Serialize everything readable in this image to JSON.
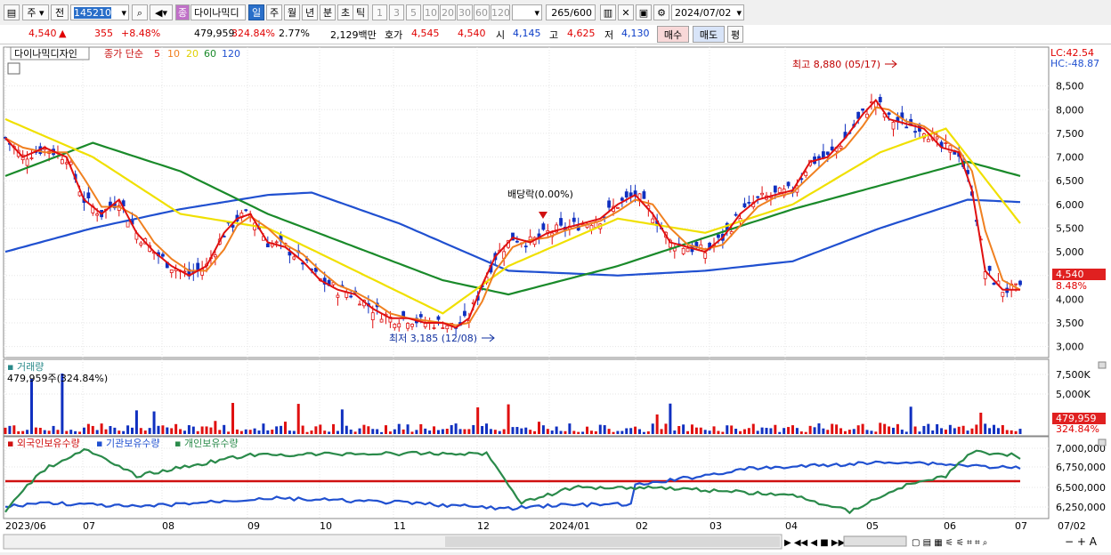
{
  "toolbar": {
    "type1": "주",
    "type2": "전",
    "code": "145210",
    "mark": "종",
    "name": "다이나믹디",
    "periods": [
      "일",
      "주",
      "월",
      "년",
      "분",
      "초",
      "틱"
    ],
    "numbers": [
      "1",
      "3",
      "5",
      "10",
      "20",
      "30",
      "60",
      "120"
    ],
    "count": "265",
    "total": "/600",
    "date": "2024/07/02"
  },
  "info": {
    "price": "4,540",
    "arrow": "▲",
    "change": "355",
    "rate": "+8.48%",
    "volume": "479,959",
    "vol_rate": "324.84%",
    "turnover": "2.77%",
    "amount": "2,129백만",
    "quote_label": "호가",
    "ask": "4,545",
    "bid": "4,540",
    "open_label": "시",
    "open": "4,145",
    "high_label": "고",
    "high": "4,625",
    "low_label": "저",
    "low": "4,130",
    "buy": "매수",
    "sell": "매도",
    "eval": "평"
  },
  "price_panel": {
    "title": "다이나믹디자인",
    "ma_label": "종가 단순",
    "ma": [
      {
        "period": "5",
        "color": "#e01010"
      },
      {
        "period": "10",
        "color": "#f08020"
      },
      {
        "period": "20",
        "color": "#f0e000"
      },
      {
        "period": "60",
        "color": "#1a8a2a"
      },
      {
        "period": "120",
        "color": "#2050d0"
      }
    ],
    "lc": "LC:42.54",
    "hc": "HC:-48.87",
    "high_note": "최고 8,880 (05/17)",
    "low_note": "최저 3,185 (12/08)",
    "div_note": "배당락(0.00%)",
    "cur_price": "4,540",
    "cur_rate": "8.48%"
  },
  "volume_panel": {
    "title": "거래량",
    "value": "479,959주(324.84%)",
    "cur": "479,959",
    "cur_rate": "324.84%"
  },
  "holdings_panel": {
    "series": [
      {
        "name": "외국인보유수량",
        "color": "#d01010"
      },
      {
        "name": "기관보유수량",
        "color": "#2050d0"
      },
      {
        "name": "개인보유수량",
        "color": "#2a8a4a"
      }
    ]
  },
  "chart_data": {
    "type": "candlestick",
    "price_axis": [
      "8,500",
      "8,000",
      "7,500",
      "7,000",
      "6,500",
      "6,000",
      "5,500",
      "5,000",
      "4,500",
      "4,000",
      "3,500",
      "3,000"
    ],
    "price_ylim": [
      2900,
      9000
    ],
    "volume_axis": [
      "7,500K",
      "5,000K"
    ],
    "holdings_axis": [
      "7,000,000",
      "6,750,000",
      "6,500,000",
      "6,250,000"
    ],
    "x_labels": [
      "2023/06",
      "07",
      "08",
      "09",
      "10",
      "11",
      "12",
      "2024/01",
      "02",
      "03",
      "04",
      "05",
      "06",
      "07",
      "07/02"
    ],
    "ma5_close": [
      [
        0,
        7400
      ],
      [
        4,
        7000
      ],
      [
        9,
        7200
      ],
      [
        14,
        7000
      ],
      [
        18,
        6100
      ],
      [
        22,
        5800
      ],
      [
        26,
        6100
      ],
      [
        30,
        5400
      ],
      [
        34,
        5000
      ],
      [
        38,
        4700
      ],
      [
        42,
        4500
      ],
      [
        46,
        4700
      ],
      [
        50,
        5400
      ],
      [
        53,
        5700
      ],
      [
        56,
        5800
      ],
      [
        60,
        5200
      ],
      [
        64,
        5100
      ],
      [
        68,
        4800
      ],
      [
        72,
        4400
      ],
      [
        76,
        4200
      ],
      [
        80,
        4100
      ],
      [
        84,
        3800
      ],
      [
        88,
        3600
      ],
      [
        92,
        3600
      ],
      [
        96,
        3500
      ],
      [
        100,
        3500
      ],
      [
        103,
        3400
      ],
      [
        106,
        3600
      ],
      [
        109,
        4300
      ],
      [
        112,
        4900
      ],
      [
        116,
        5300
      ],
      [
        120,
        5200
      ],
      [
        124,
        5400
      ],
      [
        128,
        5500
      ],
      [
        132,
        5600
      ],
      [
        136,
        5700
      ],
      [
        140,
        6000
      ],
      [
        144,
        6200
      ],
      [
        148,
        5800
      ],
      [
        152,
        5200
      ],
      [
        156,
        5100
      ],
      [
        160,
        5000
      ],
      [
        164,
        5300
      ],
      [
        168,
        5800
      ],
      [
        172,
        6100
      ],
      [
        176,
        6200
      ],
      [
        180,
        6300
      ],
      [
        184,
        6900
      ],
      [
        188,
        7000
      ],
      [
        192,
        7400
      ],
      [
        196,
        7900
      ],
      [
        199,
        8200
      ],
      [
        202,
        7800
      ],
      [
        206,
        7700
      ],
      [
        210,
        7600
      ],
      [
        214,
        7200
      ],
      [
        218,
        7100
      ],
      [
        221,
        6300
      ],
      [
        224,
        4600
      ],
      [
        228,
        4200
      ],
      [
        232,
        4200
      ]
    ],
    "ma20": [
      [
        0,
        7800
      ],
      [
        20,
        7000
      ],
      [
        40,
        5800
      ],
      [
        60,
        5500
      ],
      [
        80,
        4600
      ],
      [
        100,
        3700
      ],
      [
        115,
        4700
      ],
      [
        140,
        5700
      ],
      [
        160,
        5400
      ],
      [
        180,
        6000
      ],
      [
        200,
        7100
      ],
      [
        215,
        7600
      ],
      [
        232,
        5600
      ]
    ],
    "ma60": [
      [
        0,
        6600
      ],
      [
        20,
        7300
      ],
      [
        40,
        6700
      ],
      [
        60,
        5800
      ],
      [
        80,
        5100
      ],
      [
        100,
        4400
      ],
      [
        115,
        4100
      ],
      [
        140,
        4700
      ],
      [
        160,
        5300
      ],
      [
        180,
        5900
      ],
      [
        200,
        6400
      ],
      [
        220,
        6900
      ],
      [
        232,
        6600
      ]
    ],
    "ma120": [
      [
        0,
        5000
      ],
      [
        20,
        5500
      ],
      [
        40,
        5900
      ],
      [
        60,
        6200
      ],
      [
        70,
        6250
      ],
      [
        90,
        5600
      ],
      [
        115,
        4600
      ],
      [
        140,
        4500
      ],
      [
        160,
        4600
      ],
      [
        180,
        4800
      ],
      [
        200,
        5500
      ],
      [
        220,
        6100
      ],
      [
        232,
        6050
      ]
    ]
  }
}
